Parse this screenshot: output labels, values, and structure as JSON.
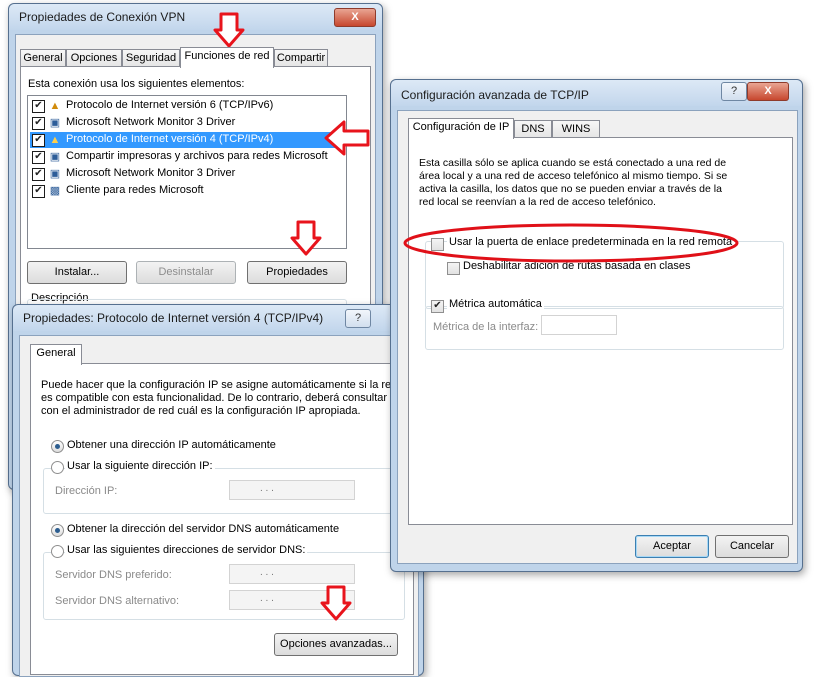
{
  "vpn": {
    "title": "Propiedades de Conexión VPN",
    "tabs": [
      "General",
      "Opciones",
      "Seguridad",
      "Funciones de red",
      "Compartir"
    ],
    "intro": "Esta conexión usa los siguientes elementos:",
    "items": [
      {
        "label": "Protocolo de Internet versión 6 (TCP/IPv6)",
        "checked": true,
        "icon": "network-protocol-icon"
      },
      {
        "label": "Microsoft Network Monitor 3 Driver",
        "checked": true,
        "icon": "network-driver-icon"
      },
      {
        "label": "Protocolo de Internet versión 4 (TCP/IPv4)",
        "checked": true,
        "icon": "network-protocol-icon"
      },
      {
        "label": "Compartir impresoras y archivos para redes Microsoft",
        "checked": true,
        "icon": "file-sharing-icon"
      },
      {
        "label": "Microsoft Network Monitor 3 Driver",
        "checked": true,
        "icon": "network-driver-icon"
      },
      {
        "label": "Cliente para redes Microsoft",
        "checked": true,
        "icon": "network-client-icon"
      }
    ],
    "install_label": "Instalar...",
    "uninstall_label": "Desinstalar",
    "properties_label": "Propiedades",
    "description_label": "Descripción"
  },
  "ipv4": {
    "title": "Propiedades: Protocolo de Internet versión 4 (TCP/IPv4)",
    "help": "?",
    "tab": "General",
    "intro": "Puede hacer que la configuración IP se asigne automáticamente si la red es compatible con esta funcionalidad. De lo contrario, deberá consultar con el administrador de red cuál es la configuración IP apropiada.",
    "intro_lines": [
      "Puede hacer que la configuración IP se asigne automáticamente si la red",
      "es compatible con esta funcionalidad. De lo contrario, deberá consultar",
      "con el administrador de red cuál es la configuración IP apropiada."
    ],
    "auto_ip": "Obtener una dirección IP automáticamente",
    "manual_ip": "Usar la siguiente dirección IP:",
    "ip_label": "Dirección IP:",
    "auto_dns": "Obtener la dirección del servidor DNS automáticamente",
    "manual_dns": "Usar las siguientes direcciones de servidor DNS:",
    "dns_pref_label": "Servidor DNS preferido:",
    "dns_alt_label": "Servidor DNS alternativo:",
    "ip_dots": ".     .     .",
    "advanced_label": "Opciones avanzadas..."
  },
  "adv": {
    "title": "Configuración avanzada de TCP/IP",
    "help": "?",
    "close": "X",
    "tabs": [
      "Configuración de IP",
      "DNS",
      "WINS"
    ],
    "desc_lines": [
      "Esta casilla sólo se aplica cuando se está conectado a una red de",
      "área local y a una red de acceso telefónico al mismo tiempo. Si se",
      "activa la casilla, los datos que no se pueden enviar a través de la",
      "red local se reenvían a la red de acceso telefónico."
    ],
    "gateway_label": "Usar la puerta de enlace predeterminada en la red remota",
    "class_route_label": "Deshabilitar adición de rutas basada en clases",
    "auto_metric_label": "Métrica automática",
    "metric_label": "Métrica de la interfaz:",
    "ok_label": "Aceptar",
    "cancel_label": "Cancelar"
  },
  "colors": {
    "arrow": "#e8141c",
    "highlight": "#3399ff",
    "ellipse": "#e01018"
  }
}
